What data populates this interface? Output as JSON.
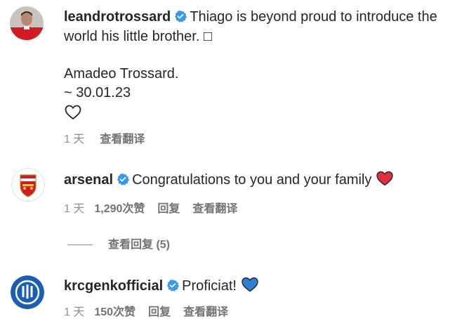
{
  "comments": [
    {
      "username": "leandrotrossard",
      "caption_line1": "Thiago is beyond proud to introduce the",
      "caption_line2": "world his little brother. ",
      "missing_glyph": "□",
      "caption_line3": "Amadeo Trossard.",
      "caption_line4": "~ 30.01.23",
      "time": "1 天",
      "translate": "查看翻译"
    },
    {
      "username": "arsenal",
      "text": "Congratulations to you and your family",
      "emoji": "red-heart",
      "time": "1 天",
      "likes": "1,290次赞",
      "reply": "回复",
      "translate": "查看翻译",
      "view_replies": "查看回复 (5)"
    },
    {
      "username": "krcgenkofficial",
      "text": "Proficiat!",
      "emoji": "blue-heart",
      "time": "1 天",
      "likes": "150次赞",
      "reply": "回复",
      "translate": "查看翻译"
    }
  ],
  "colors": {
    "verified": "#3897f0",
    "red_heart": "#e02e3a",
    "blue_heart": "#2f7fd6",
    "secondary_text": "#737373"
  }
}
